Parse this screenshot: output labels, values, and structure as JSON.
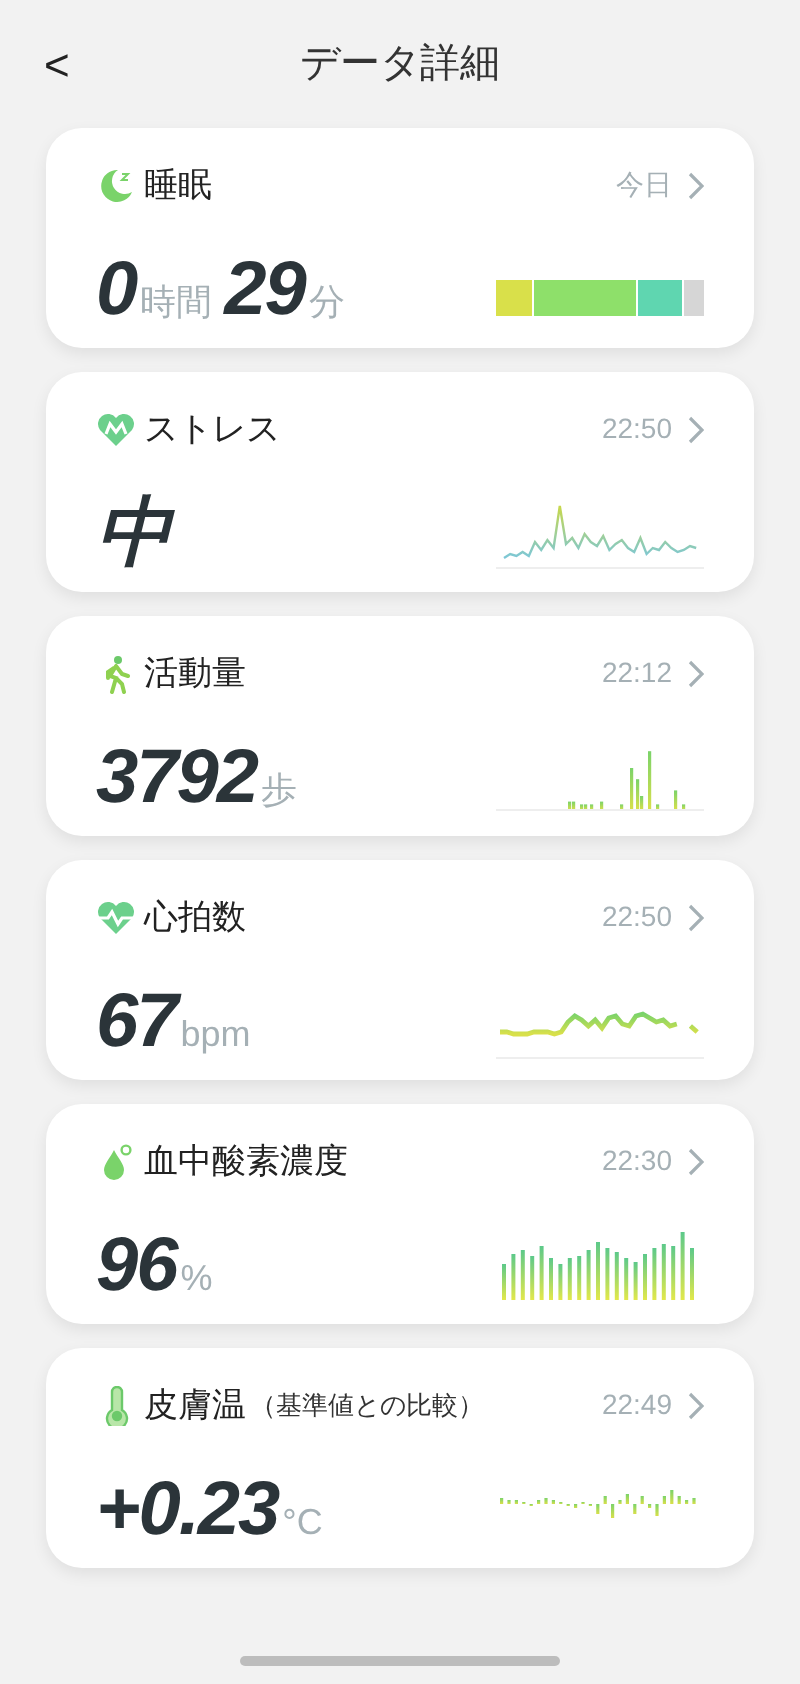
{
  "header": {
    "back": "<",
    "title": "データ詳細"
  },
  "cards": [
    {
      "kind": "sleep",
      "title": "睡眠",
      "time": "今日",
      "value": [
        {
          "kind": "number",
          "text": "0"
        },
        {
          "kind": "unit",
          "text": "時間"
        },
        {
          "kind": "number",
          "text": "29"
        },
        {
          "kind": "unit",
          "text": "分"
        }
      ]
    },
    {
      "kind": "stress",
      "title": "ストレス",
      "time": "22:50",
      "value": [
        {
          "kind": "number",
          "text": "中"
        }
      ]
    },
    {
      "kind": "activity",
      "title": "活動量",
      "time": "22:12",
      "value": [
        {
          "kind": "number",
          "text": "3792"
        },
        {
          "kind": "unit",
          "text": "歩"
        }
      ]
    },
    {
      "kind": "heart",
      "title": "心拍数",
      "time": "22:50",
      "value": [
        {
          "kind": "number",
          "text": "67"
        },
        {
          "kind": "unit",
          "text": "bpm"
        }
      ]
    },
    {
      "kind": "oxygen",
      "title": "血中酸素濃度",
      "time": "22:30",
      "value": [
        {
          "kind": "number",
          "text": "96"
        },
        {
          "kind": "unit",
          "text": "%"
        }
      ]
    },
    {
      "kind": "temp",
      "title": "皮膚温",
      "note": "（基準値との比較）",
      "time": "22:49",
      "value": [
        {
          "kind": "number",
          "text": "+0.23"
        },
        {
          "kind": "unit",
          "text": "°C"
        }
      ]
    }
  ]
}
